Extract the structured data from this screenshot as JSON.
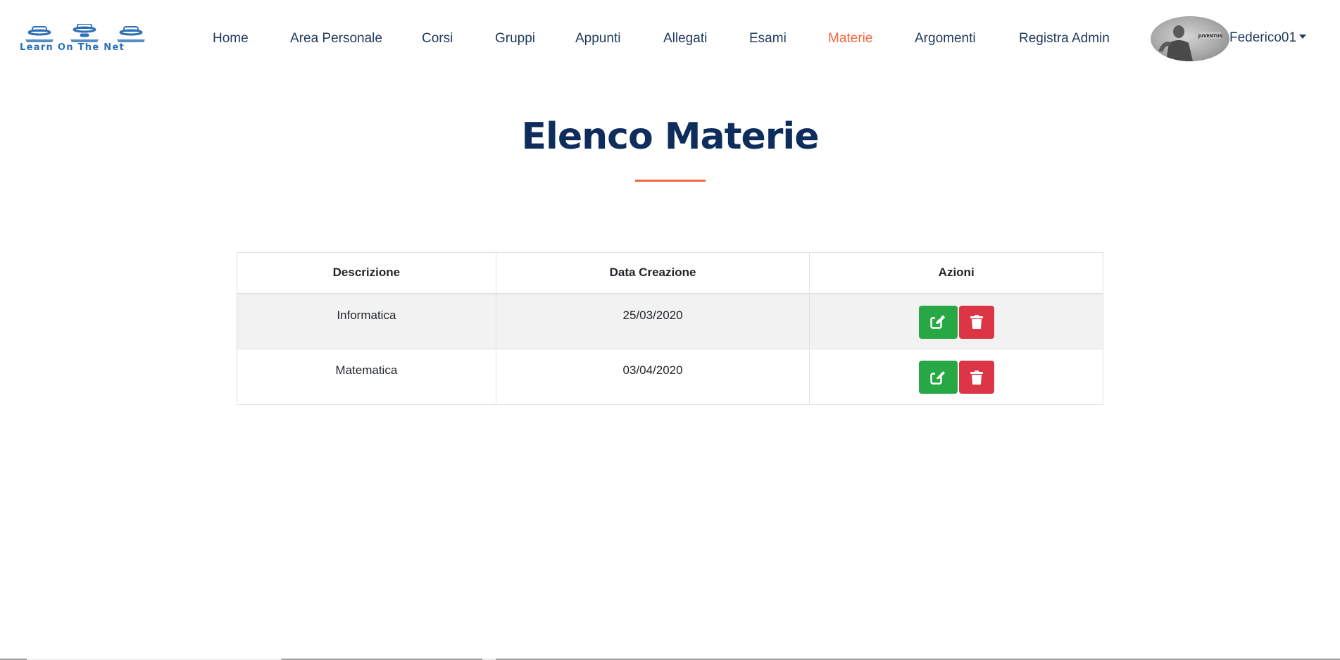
{
  "header": {
    "logo_text": "Learn On The Net",
    "nav": [
      {
        "label": "Home",
        "active": false
      },
      {
        "label": "Area Personale",
        "active": false
      },
      {
        "label": "Corsi",
        "active": false
      },
      {
        "label": "Gruppi",
        "active": false
      },
      {
        "label": "Appunti",
        "active": false
      },
      {
        "label": "Allegati",
        "active": false
      },
      {
        "label": "Esami",
        "active": false
      },
      {
        "label": "Materie",
        "active": true
      },
      {
        "label": "Argomenti",
        "active": false
      },
      {
        "label": "Registra Admin",
        "active": false
      }
    ],
    "user": {
      "name": "Federico01",
      "avatar_badge": "JUVENTUS"
    }
  },
  "page": {
    "title": "Elenco Materie"
  },
  "table": {
    "headers": [
      "Descrizione",
      "Data Creazione",
      "Azioni"
    ],
    "rows": [
      {
        "descrizione": "Informatica",
        "data_creazione": "25/03/2020"
      },
      {
        "descrizione": "Matematica",
        "data_creazione": "03/04/2020"
      }
    ],
    "edit_icon": "edit-icon",
    "delete_icon": "trash-icon"
  },
  "colors": {
    "accent": "#f26640",
    "title": "#0f2d5c",
    "nav": "#1f3a5c",
    "edit": "#28a745",
    "delete": "#dc3545"
  }
}
